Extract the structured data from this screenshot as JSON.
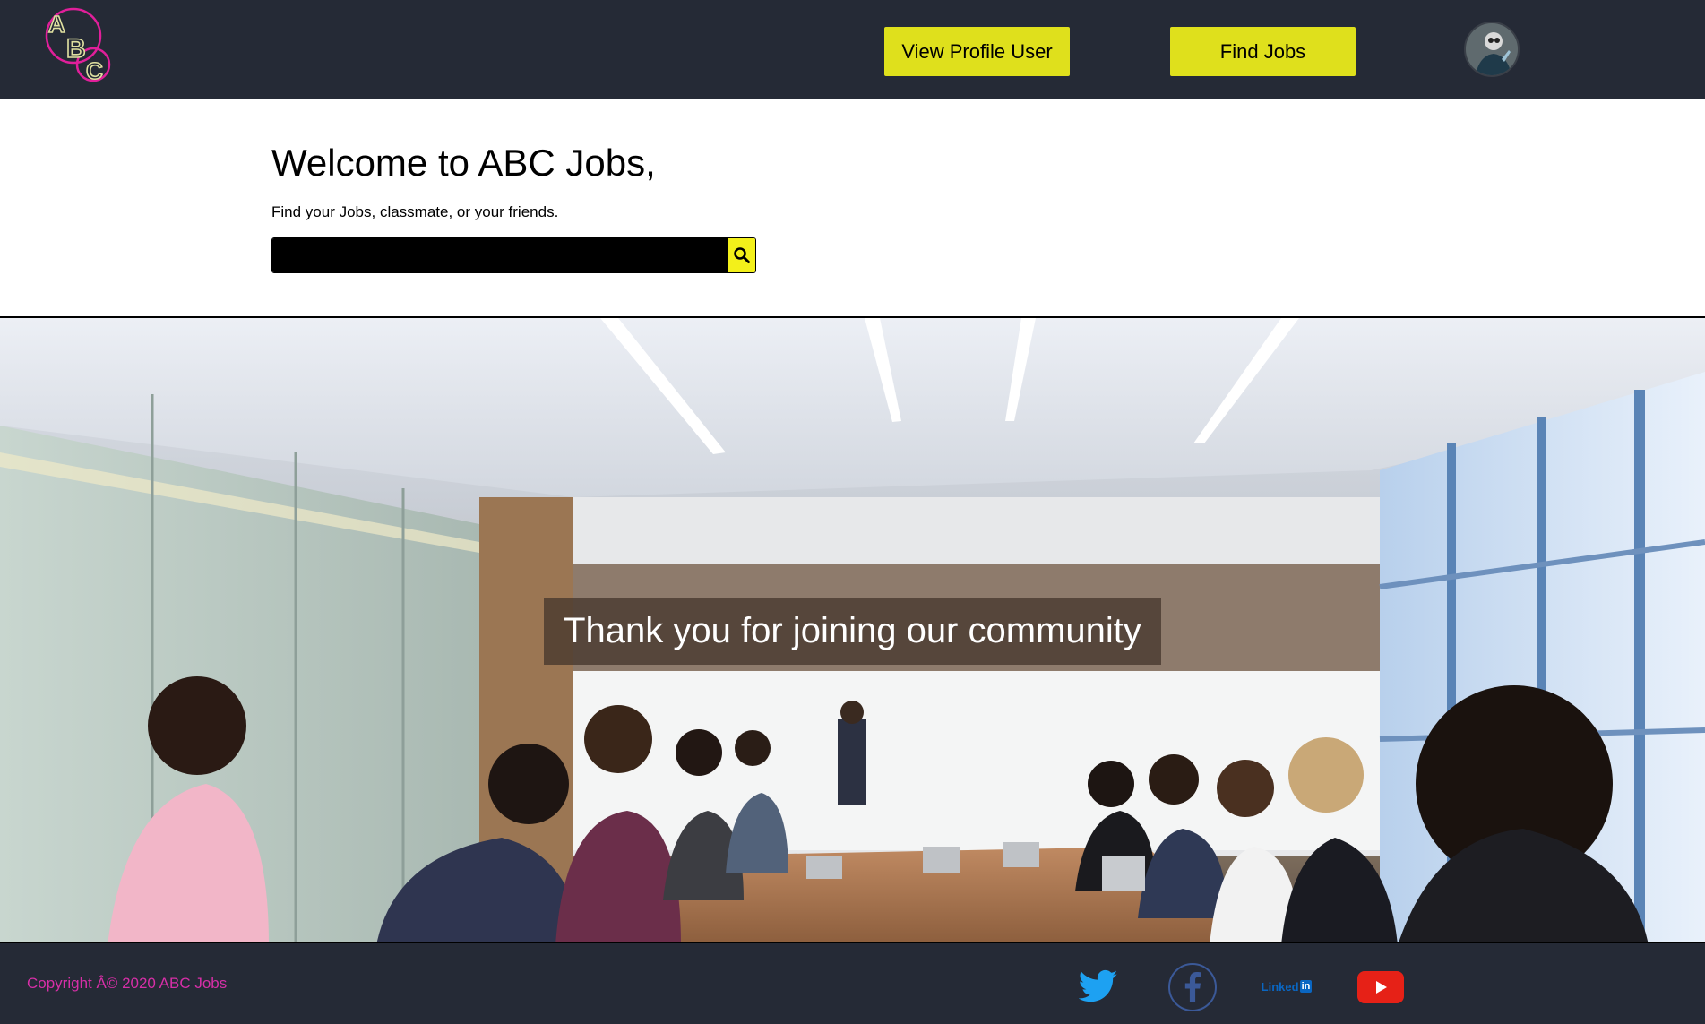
{
  "header": {
    "logo_letters": [
      "A",
      "B",
      "C"
    ],
    "profile_button_label": "View Profile User",
    "jobs_button_label": "Find Jobs"
  },
  "welcome": {
    "title": "Welcome to ABC Jobs,",
    "subtitle": "Find your Jobs, classmate, or your friends.",
    "search_value": ""
  },
  "hero": {
    "caption": "Thank you for joining our community"
  },
  "footer": {
    "copyright": "Copyright Â© 2020 ABC Jobs",
    "linkedin_label": "Linked",
    "linkedin_suffix": "in",
    "social_icons": [
      "twitter-icon",
      "facebook-icon",
      "linkedin-icon",
      "youtube-icon"
    ]
  },
  "colors": {
    "navbar": "#252a36",
    "button_yellow": "#dfe01c",
    "search_button": "#f3f01a",
    "copyright_pink": "#d62fa7",
    "twitter_blue": "#1da1f2",
    "facebook_blue": "#3b5998",
    "youtube_red": "#e62117"
  }
}
